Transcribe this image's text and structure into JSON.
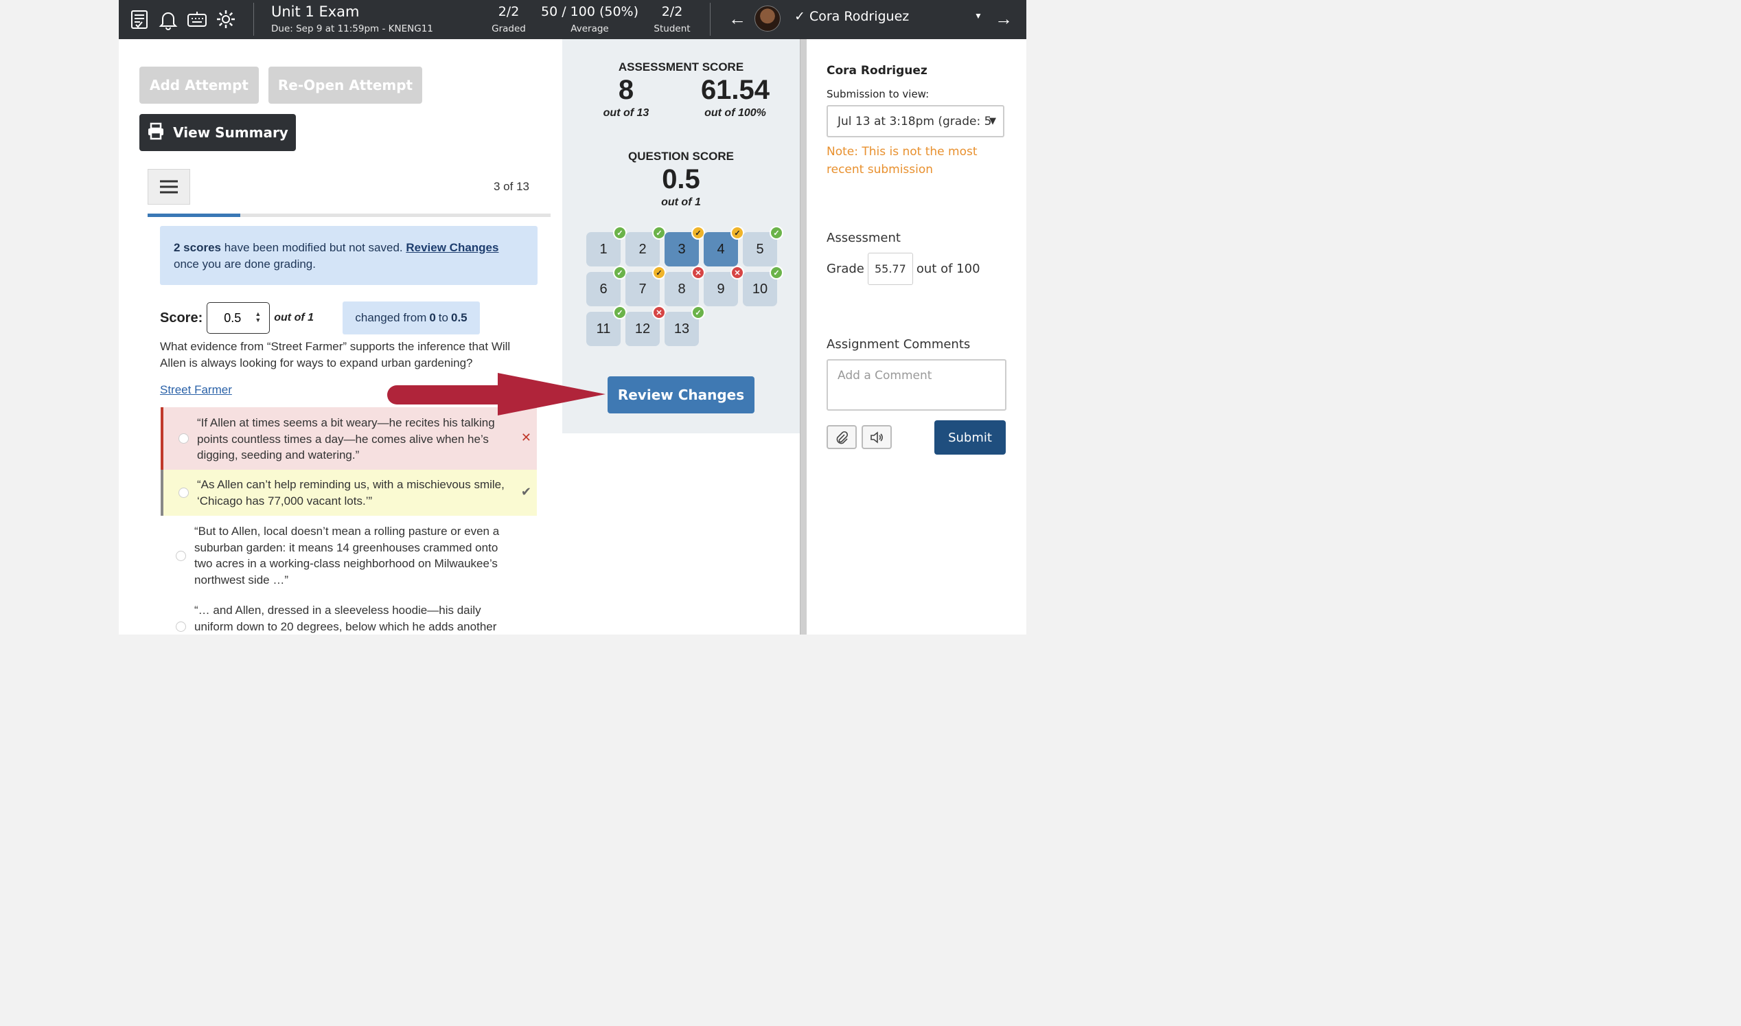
{
  "header": {
    "exam_title": "Unit 1 Exam",
    "exam_due": "Due: Sep 9 at 11:59pm - KNENG11",
    "graded_value": "2/2",
    "graded_label": "Graded",
    "average_value": "50 / 100 (50%)",
    "average_label": "Average",
    "student_value": "2/2",
    "student_label": "Student",
    "student_name": "Cora Rodriguez",
    "prev_arrow": "←",
    "next_arrow": "→",
    "check_glyph": "✓",
    "caret": "▼",
    "icons": [
      "gradebook-icon",
      "bell-icon",
      "keyboard-icon",
      "gear-icon"
    ]
  },
  "left": {
    "add_attempt": "Add Attempt",
    "reopen_attempt": "Re-Open Attempt",
    "view_summary": "View Summary",
    "page_count": "3 of 13",
    "progress_fraction": 0.23,
    "notice_bold": "2 scores",
    "notice_text": " have been modified but not saved. ",
    "notice_link": "Review Changes",
    "notice_tail": "once you are done grading.",
    "score_label": "Score:",
    "score_value": "0.5",
    "score_outof": "out of 1",
    "changed_pre": "changed from ",
    "changed_from": "0",
    "changed_mid": " to ",
    "changed_to": "0.5",
    "question": "What evidence from “Street Farmer” supports the inference that Will Allen is always looking for ways to expand urban gardening?",
    "passage_link": "Street Farmer",
    "answers": [
      {
        "text": "“If Allen at times seems a bit weary—he recites his talking points countless times a day—he comes alive when he’s digging, seeding and watering.”",
        "mark": "✕"
      },
      {
        "text": "“As Allen can’t help reminding us, with a mischievous smile, ‘Chicago has 77,000 vacant lots.’”",
        "mark": "✔"
      },
      {
        "text": "“But to Allen, local doesn’t mean a rolling pasture or even a suburban garden: it means 14 greenhouses crammed onto two acres in a working-class neighborhood on Milwaukee’s northwest side …”",
        "mark": ""
      },
      {
        "text": "“… and Allen, dressed in a sleeveless hoodie—his daily uniform down to 20 degrees, below which he adds another",
        "mark": ""
      }
    ]
  },
  "middle": {
    "assessment_heading": "ASSESSMENT SCORE",
    "assessment_points": "8",
    "assessment_points_sub": "out of 13",
    "assessment_pct": "61.54",
    "assessment_pct_sub": "out of 100%",
    "question_heading": "QUESTION SCORE",
    "question_score": "0.5",
    "question_score_sub": "out of 1",
    "review_button": "Review Changes",
    "questions": [
      {
        "n": "1",
        "status": "correct",
        "current": false
      },
      {
        "n": "2",
        "status": "correct",
        "current": false
      },
      {
        "n": "3",
        "status": "partial",
        "current": true
      },
      {
        "n": "4",
        "status": "partial",
        "current": true
      },
      {
        "n": "5",
        "status": "correct",
        "current": false
      },
      {
        "n": "6",
        "status": "correct",
        "current": false
      },
      {
        "n": "7",
        "status": "partial",
        "current": false
      },
      {
        "n": "8",
        "status": "incorrect",
        "current": false
      },
      {
        "n": "9",
        "status": "incorrect",
        "current": false
      },
      {
        "n": "10",
        "status": "correct",
        "current": false
      },
      {
        "n": "11",
        "status": "correct",
        "current": false
      },
      {
        "n": "12",
        "status": "incorrect",
        "current": false
      },
      {
        "n": "13",
        "status": "correct",
        "current": false
      }
    ]
  },
  "right": {
    "student_name": "Cora Rodriguez",
    "submission_label": "Submission to view:",
    "submission_value": "Jul 13 at 3:18pm (grade: 5",
    "note": "Note: This is not the most recent submission",
    "assessment_label": "Assessment",
    "grade_label": "Grade",
    "grade_value": "55.77",
    "grade_outof": "out of 100",
    "comments_label": "Assignment Comments",
    "comment_placeholder": "Add a Comment",
    "submit": "Submit"
  },
  "colors": {
    "topbar": "#2e3135",
    "accent_blue": "#3f79b3",
    "submit_blue": "#1f4e7e",
    "note_orange": "#e8902e",
    "arrow_red": "#b0243a",
    "correct_green": "#6bb34a",
    "partial_yellow": "#f0b429",
    "incorrect_red": "#d64545"
  }
}
